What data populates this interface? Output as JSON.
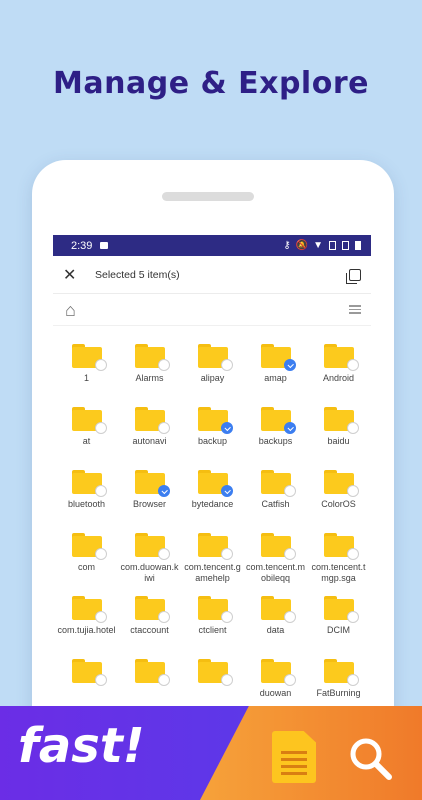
{
  "headline": "Manage & Explore",
  "status_bar": {
    "time": "2:39"
  },
  "toolbar": {
    "title": "Selected 5 item(s)"
  },
  "folders": [
    {
      "name": "1",
      "checked": false
    },
    {
      "name": "Alarms",
      "checked": false
    },
    {
      "name": "alipay",
      "checked": false
    },
    {
      "name": "amap",
      "checked": true
    },
    {
      "name": "Android",
      "checked": false
    },
    {
      "name": "at",
      "checked": false
    },
    {
      "name": "autonavi",
      "checked": false
    },
    {
      "name": "backup",
      "checked": true
    },
    {
      "name": "backups",
      "checked": true
    },
    {
      "name": "baidu",
      "checked": false
    },
    {
      "name": "bluetooth",
      "checked": false
    },
    {
      "name": "Browser",
      "checked": true
    },
    {
      "name": "bytedance",
      "checked": true
    },
    {
      "name": "Catfish",
      "checked": false
    },
    {
      "name": "ColorOS",
      "checked": false
    },
    {
      "name": "com",
      "checked": false
    },
    {
      "name": "com.duowan.kiwi",
      "checked": false
    },
    {
      "name": "com.tencent.gamehelp",
      "checked": false
    },
    {
      "name": "com.tencent.mobileqq",
      "checked": false
    },
    {
      "name": "com.tencent.tmgp.sga",
      "checked": false
    },
    {
      "name": "com.tujia.hotel",
      "checked": false
    },
    {
      "name": "ctaccount",
      "checked": false
    },
    {
      "name": "ctclient",
      "checked": false
    },
    {
      "name": "data",
      "checked": false
    },
    {
      "name": "DCIM",
      "checked": false
    },
    {
      "name": "",
      "checked": false
    },
    {
      "name": "",
      "checked": false
    },
    {
      "name": "",
      "checked": false
    },
    {
      "name": "duowan",
      "checked": false
    },
    {
      "name": "FatBurning",
      "checked": false
    }
  ],
  "banner": {
    "tagline": "fast!"
  },
  "colors": {
    "accent": "#2d2b84",
    "folder": "#fcca1d",
    "check": "#3c7ef0",
    "banner_purple": "#6b2de6",
    "banner_orange": "#f07a2a"
  },
  "icons": [
    "close-icon",
    "select-all-icon",
    "home-icon",
    "list-view-icon",
    "document-icon",
    "search-icon"
  ]
}
